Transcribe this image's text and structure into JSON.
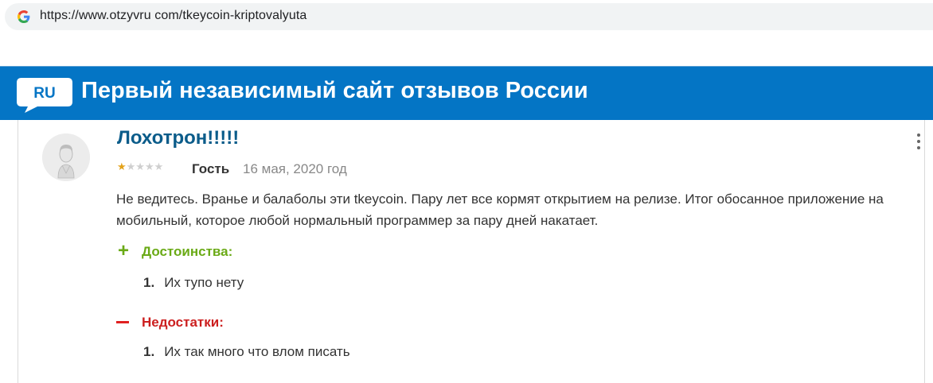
{
  "browser": {
    "url": "https://www.otzyvru com/tkeycoin-kriptovalyuta"
  },
  "site": {
    "logo_text": "RU",
    "banner_title": "Первый независимый сайт отзывов России",
    "brand_color": "#0475c5"
  },
  "review": {
    "title": "Лохотрон!!!!!",
    "rating": 1,
    "rating_max": 5,
    "author": "Гость",
    "date": "16 мая, 2020 год",
    "text": "Не ведитесь. Вранье и балаболы эти tkeycoin. Пару лет все кормят открытием на релизе. Итог обосанное приложение на мобильный, которое любой нормальный программер за пару дней накатает.",
    "pros": {
      "sign": "+",
      "label": "Достоинства:",
      "items": [
        {
          "num": "1.",
          "text": "Их тупо нету"
        }
      ]
    },
    "cons": {
      "label": "Недостатки:",
      "items": [
        {
          "num": "1.",
          "text": "Их так много что влом писать"
        }
      ]
    }
  },
  "icons": {
    "google": "google-g-icon",
    "logo": "ru-speech-bubble-logo",
    "menu": "kebab-menu-icon",
    "avatar": "default-user-avatar"
  }
}
